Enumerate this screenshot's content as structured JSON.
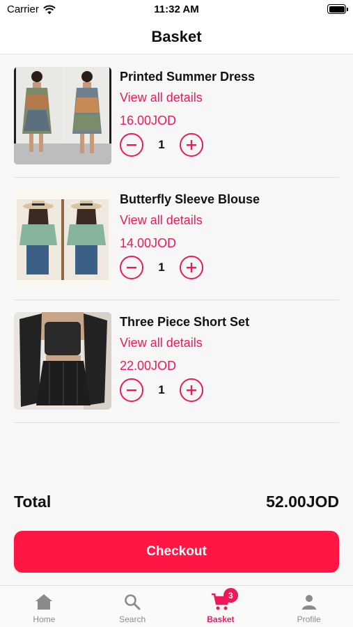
{
  "status_bar": {
    "carrier": "Carrier",
    "time": "11:32 AM"
  },
  "header": {
    "title": "Basket"
  },
  "items": [
    {
      "name": "Printed Summer Dress",
      "details_link": "View all details",
      "price": "16.00JOD",
      "quantity": "1"
    },
    {
      "name": "Butterfly Sleeve Blouse",
      "details_link": "View all details",
      "price": "14.00JOD",
      "quantity": "1"
    },
    {
      "name": "Three Piece Short Set",
      "details_link": "View all details",
      "price": "22.00JOD",
      "quantity": "1"
    }
  ],
  "summary": {
    "total_label": "Total",
    "total_amount": "52.00JOD"
  },
  "checkout": {
    "label": "Checkout"
  },
  "tabs": [
    {
      "label": "Home",
      "icon": "home-icon"
    },
    {
      "label": "Search",
      "icon": "search-icon"
    },
    {
      "label": "Basket",
      "icon": "cart-icon",
      "badge": "3",
      "active": true
    },
    {
      "label": "Profile",
      "icon": "person-icon"
    }
  ],
  "colors": {
    "accent": "#f0185a",
    "checkout_bg": "#ff1744",
    "inactive": "#8a8a8a"
  }
}
